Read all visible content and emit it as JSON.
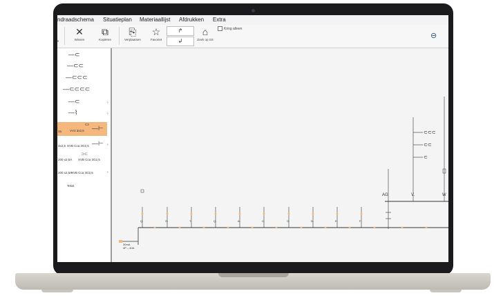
{
  "menu": [
    "ndraadschema",
    "Situatieplan",
    "Materiaallijst",
    "Afdrukken",
    "Extra"
  ],
  "toolbar": {
    "buttons": [
      {
        "label": "Wissen",
        "icon": "close-x-icon"
      },
      {
        "label": "Kopiëren",
        "icon": "copy-icon"
      },
      {
        "label": "Verplaatsen",
        "icon": "move-icon"
      },
      {
        "label": "Favoriet",
        "icon": "star-icon"
      },
      {
        "label": "Zoek op SS",
        "icon": "house-search-icon"
      }
    ],
    "edge_label": "n",
    "checkbox_label": "Kring alleen"
  },
  "sidebar": {
    "items": [
      {
        "symbol": "—⊂"
      },
      {
        "symbol": "—⊂⊂"
      },
      {
        "symbol": "—⊂⊂⊂"
      },
      {
        "symbol": "—⊂⊂⊂⊂"
      },
      {
        "symbol": "—⊂"
      },
      {
        "symbol": "—⌇"
      },
      {
        "symbol": "—⊢",
        "top_text": "C2",
        "text": "VV3 3x2,5",
        "prefix": "3a"
      },
      {
        "symbol": "—⊢",
        "text": "XVB Cca 3G2,5",
        "prefix": "3x2,5"
      },
      {
        "symbol": "⊃⊂",
        "text": "XVB Cca 3G2,5",
        "prefix": "200 x2,5A"
      },
      {
        "symbol": "",
        "text": "XVB Cca 3G2,5",
        "prefix": "200 x2,5A"
      },
      {
        "symbol": "",
        "text": "Tekst",
        "prefix": ""
      }
    ]
  },
  "canvas": {
    "circuit_labels": [
      "Q.",
      "G.",
      "T.",
      "Q.",
      "A.",
      "C.",
      "O.",
      "D.",
      "E.",
      "F."
    ],
    "group_labels": [
      "AG",
      "V.",
      "W"
    ],
    "bottom_label_1": "30mA",
    "bottom_label_2": "4P – 40A"
  },
  "colors": {
    "accent": "#f6b77c",
    "lid": "#1b1b1d",
    "canvas": "#f4f4f4"
  }
}
